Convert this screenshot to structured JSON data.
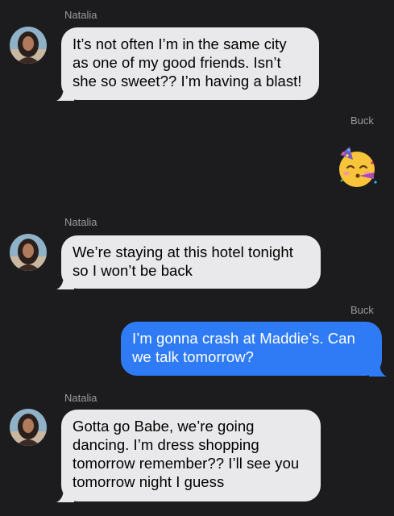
{
  "conversation": {
    "messages": [
      {
        "sender": "Natalia",
        "direction": "incoming",
        "lines": [
          "It’s not often I’m in the same city",
          "as one of my good friends. Isn’t",
          "she so sweet?? I’m having a blast!"
        ]
      },
      {
        "sender": "Buck",
        "direction": "outgoing",
        "type": "emoji",
        "emoji": "partying-face"
      },
      {
        "sender": "Natalia",
        "direction": "incoming",
        "lines": [
          "We’re staying at this hotel tonight",
          "so I won’t be back"
        ]
      },
      {
        "sender": "Buck",
        "direction": "outgoing",
        "lines": [
          "I’m gonna crash at Maddie’s. Can",
          "we talk tomorrow?"
        ]
      },
      {
        "sender": "Natalia",
        "direction": "incoming",
        "lines": [
          "Gotta go Babe, we’re going",
          "dancing. I’m dress shopping",
          "tomorrow remember?? I’ll see you",
          "tomorrow night I guess"
        ]
      }
    ]
  },
  "colors": {
    "background": "#1c1c1e",
    "incoming_bubble": "#e9e9eb",
    "outgoing_bubble": "#2f7bf5",
    "sender_label": "#9b9ba0"
  }
}
